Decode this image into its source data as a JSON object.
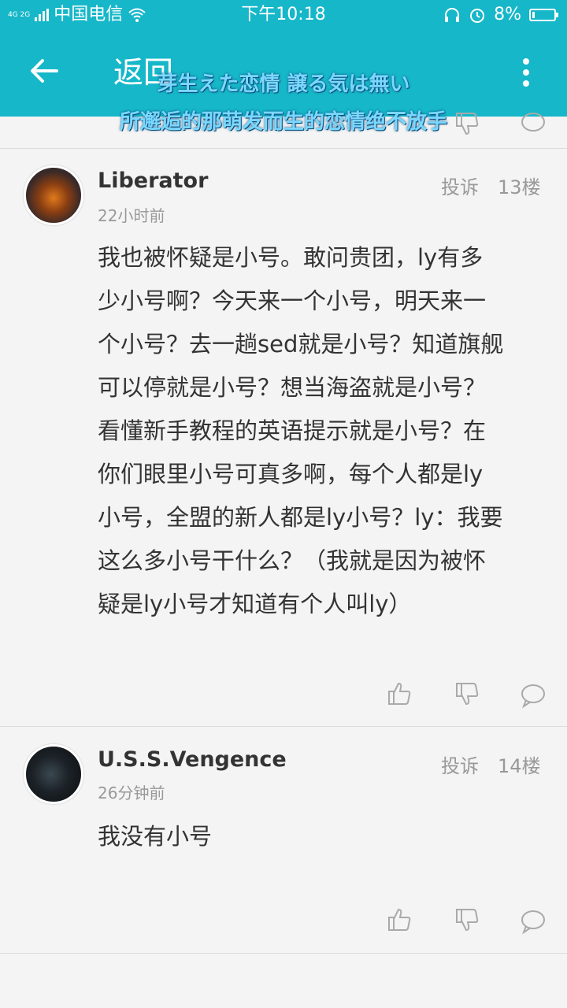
{
  "status_bar": {
    "network": "4G 2G",
    "carrier": "中国电信",
    "time": "下午10:18",
    "battery": "8%"
  },
  "nav": {
    "back_label": "返回"
  },
  "overlay_lyrics": {
    "japanese": "芽生えた恋情 譲る気は無い",
    "chinese": "所邂逅的那萌发而生的恋情绝不放手"
  },
  "comments": [
    {
      "username": "Liberator",
      "time": "22小时前",
      "report": "投诉",
      "floor": "13楼",
      "text": "我也被怀疑是小号。敢问贵团，ly有多\n少小号啊？今天来一个小号，明天来一\n个小号？去一趟sed就是小号？知道旗舰\n可以停就是小号？想当海盗就是小号？\n看懂新手教程的英语提示就是小号？在\n你们眼里小号可真多啊，每个人都是ly\n小号，全盟的新人都是ly小号？ly：我要\n这么多小号干什么？（我就是因为被怀\n疑是ly小号才知道有个人叫ly）"
    },
    {
      "username": "U.S.S.Vengence",
      "time": "26分钟前",
      "report": "投诉",
      "floor": "14楼",
      "text": "我没有小号"
    }
  ],
  "colors": {
    "accent": "#16b7c9",
    "overlay_text": "#7ad8ff",
    "muted": "#999999",
    "text": "#333333"
  },
  "icons": [
    "back-arrow-icon",
    "more-vertical-icon",
    "thumbs-up-icon",
    "thumbs-down-icon",
    "comment-bubble-icon",
    "headphone-icon",
    "alarm-icon",
    "wifi-icon",
    "battery-icon"
  ]
}
